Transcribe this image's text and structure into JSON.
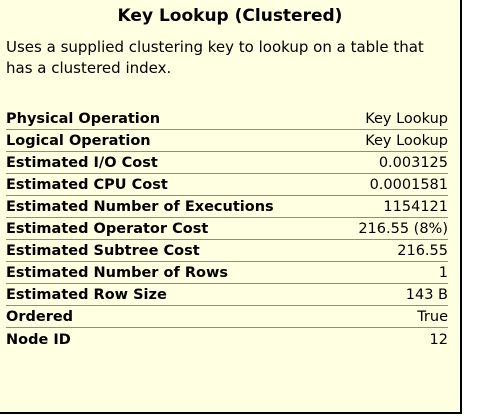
{
  "tooltip": {
    "title": "Key Lookup (Clustered)",
    "description": "Uses a supplied clustering key to lookup on a table that has a clustered index.",
    "background_color": "#ffffe1",
    "border_color": "#000000",
    "properties": [
      {
        "label": "Physical Operation",
        "value": "Key Lookup"
      },
      {
        "label": "Logical Operation",
        "value": "Key Lookup"
      },
      {
        "label": "Estimated I/O Cost",
        "value": "0.003125"
      },
      {
        "label": "Estimated CPU Cost",
        "value": "0.0001581"
      },
      {
        "label": "Estimated Number of Executions",
        "value": "1154121"
      },
      {
        "label": "Estimated Operator Cost",
        "value": "216.55 (8%)"
      },
      {
        "label": "Estimated Subtree Cost",
        "value": "216.55"
      },
      {
        "label": "Estimated Number of Rows",
        "value": "1"
      },
      {
        "label": "Estimated Row Size",
        "value": "143 B"
      },
      {
        "label": "Ordered",
        "value": "True"
      },
      {
        "label": "Node ID",
        "value": "12"
      }
    ]
  }
}
